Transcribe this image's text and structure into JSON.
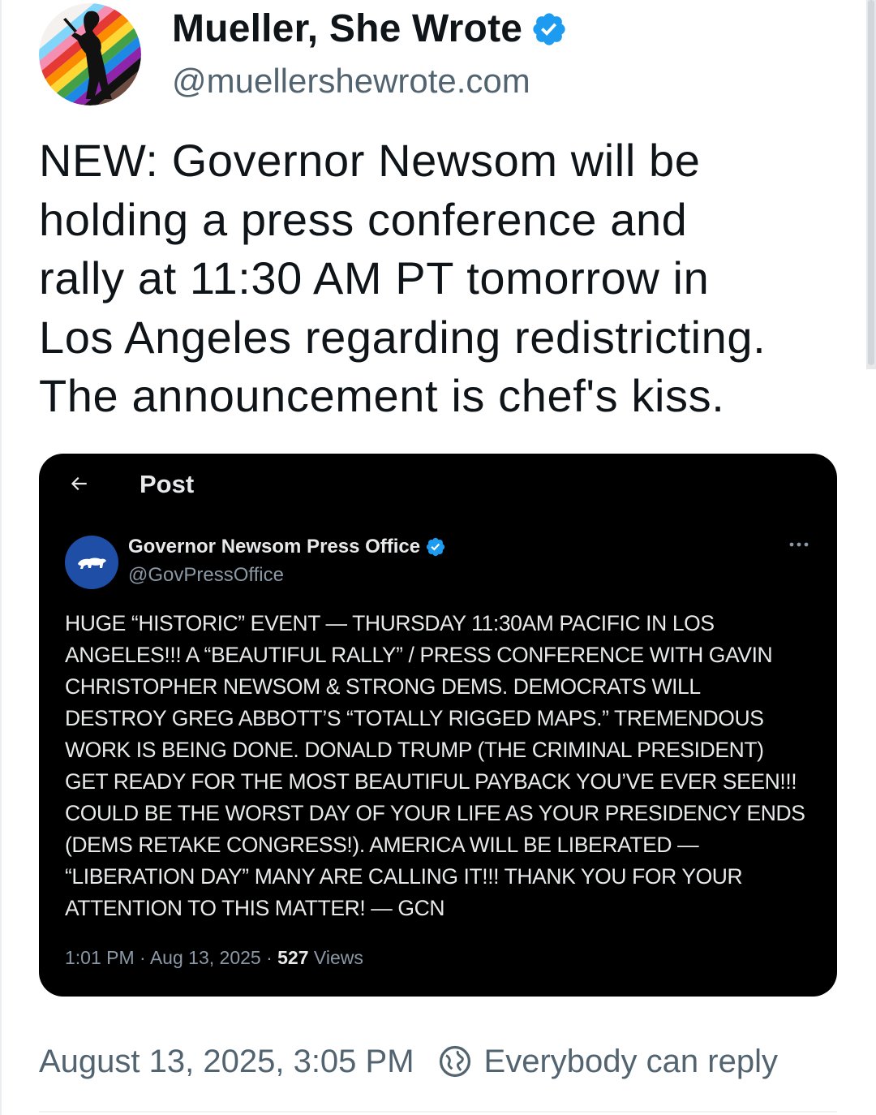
{
  "author": {
    "display_name": "Mueller, She Wrote",
    "handle": "@muellershewrote.com",
    "avatar_icon": "rainbow-silhouette-avatar",
    "verified_icon": "verified-badge-icon"
  },
  "post": {
    "lines": [
      "NEW: Governor Newsom will be",
      "holding a press conference and",
      "rally at 11:30 AM PT tomorrow in",
      "Los Angeles regarding redistricting.",
      "The announcement is chef's kiss."
    ]
  },
  "embed": {
    "topbar": {
      "back_icon": "back-arrow-icon",
      "title": "Post"
    },
    "author": {
      "name": "Governor Newsom Press Office",
      "handle": "@GovPressOffice",
      "avatar_icon": "california-bear-icon"
    },
    "more_icon": "more-options-icon",
    "body_lines": [
      "HUGE “HISTORIC” EVENT — THURSDAY 11:30AM PACIFIC IN LOS",
      "ANGELES!!!  A “BEAUTIFUL RALLY” / PRESS CONFERENCE WITH GAVIN",
      "CHRISTOPHER NEWSOM & STRONG DEMS. DEMOCRATS WILL",
      "DESTROY GREG ABBOTT’S “TOTALLY RIGGED MAPS.” TREMENDOUS",
      "WORK IS BEING DONE.  DONALD TRUMP (THE CRIMINAL PRESIDENT)",
      "GET READY FOR THE MOST BEAUTIFUL PAYBACK YOU’VE EVER SEEN!!!",
      "COULD BE THE WORST DAY OF YOUR LIFE AS YOUR PRESIDENCY ENDS",
      "(DEMS RETAKE CONGRESS!). AMERICA WILL BE LIBERATED —",
      "“LIBERATION DAY” MANY ARE CALLING IT!!! THANK YOU FOR YOUR",
      "ATTENTION TO THIS MATTER! — GCN"
    ],
    "meta": {
      "time": "1:01 PM",
      "separator": "·",
      "date": "Aug 13, 2025",
      "views_count": "527",
      "views_label": "Views"
    }
  },
  "footer": {
    "timestamp": "August 13, 2025, 3:05 PM",
    "reply_icon": "reply-restriction-globe-icon",
    "reply_setting": "Everybody can reply"
  },
  "colors": {
    "verified_blue": "#1d9bf0",
    "secondary_text": "#536471",
    "embed_background": "#000000",
    "gov_avatar_blue": "#1f4ea7"
  }
}
